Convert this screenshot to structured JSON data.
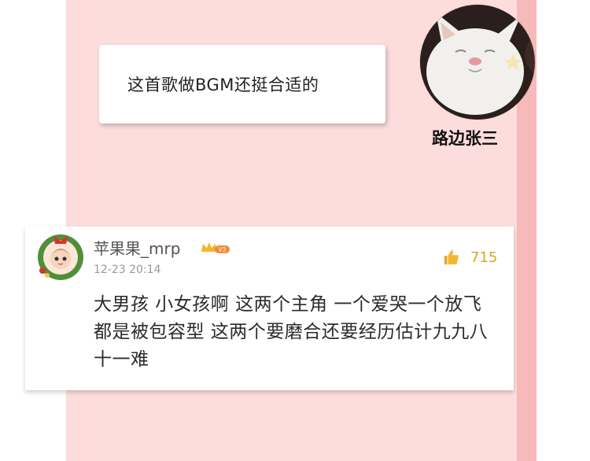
{
  "post": {
    "bubble_text": "这首歌做BGM还挺合适的",
    "username": "路边张三",
    "avatar_icon": "white-cat-avatar-icon"
  },
  "comment": {
    "username": "苹果果_mrp",
    "badge_text": "V3",
    "time": "12-23 20:14",
    "like_count": "715",
    "text": "大男孩 小女孩啊 这两个主角 一个爱哭一个放飞 都是被包容型 这两个要磨合还要经历估计九九八十一难",
    "avatar_icon": "christmas-wreath-avatar-icon"
  },
  "colors": {
    "panel_bg": "#fddcdc",
    "strip": "#f7b9b9",
    "like": "#d9a528"
  }
}
